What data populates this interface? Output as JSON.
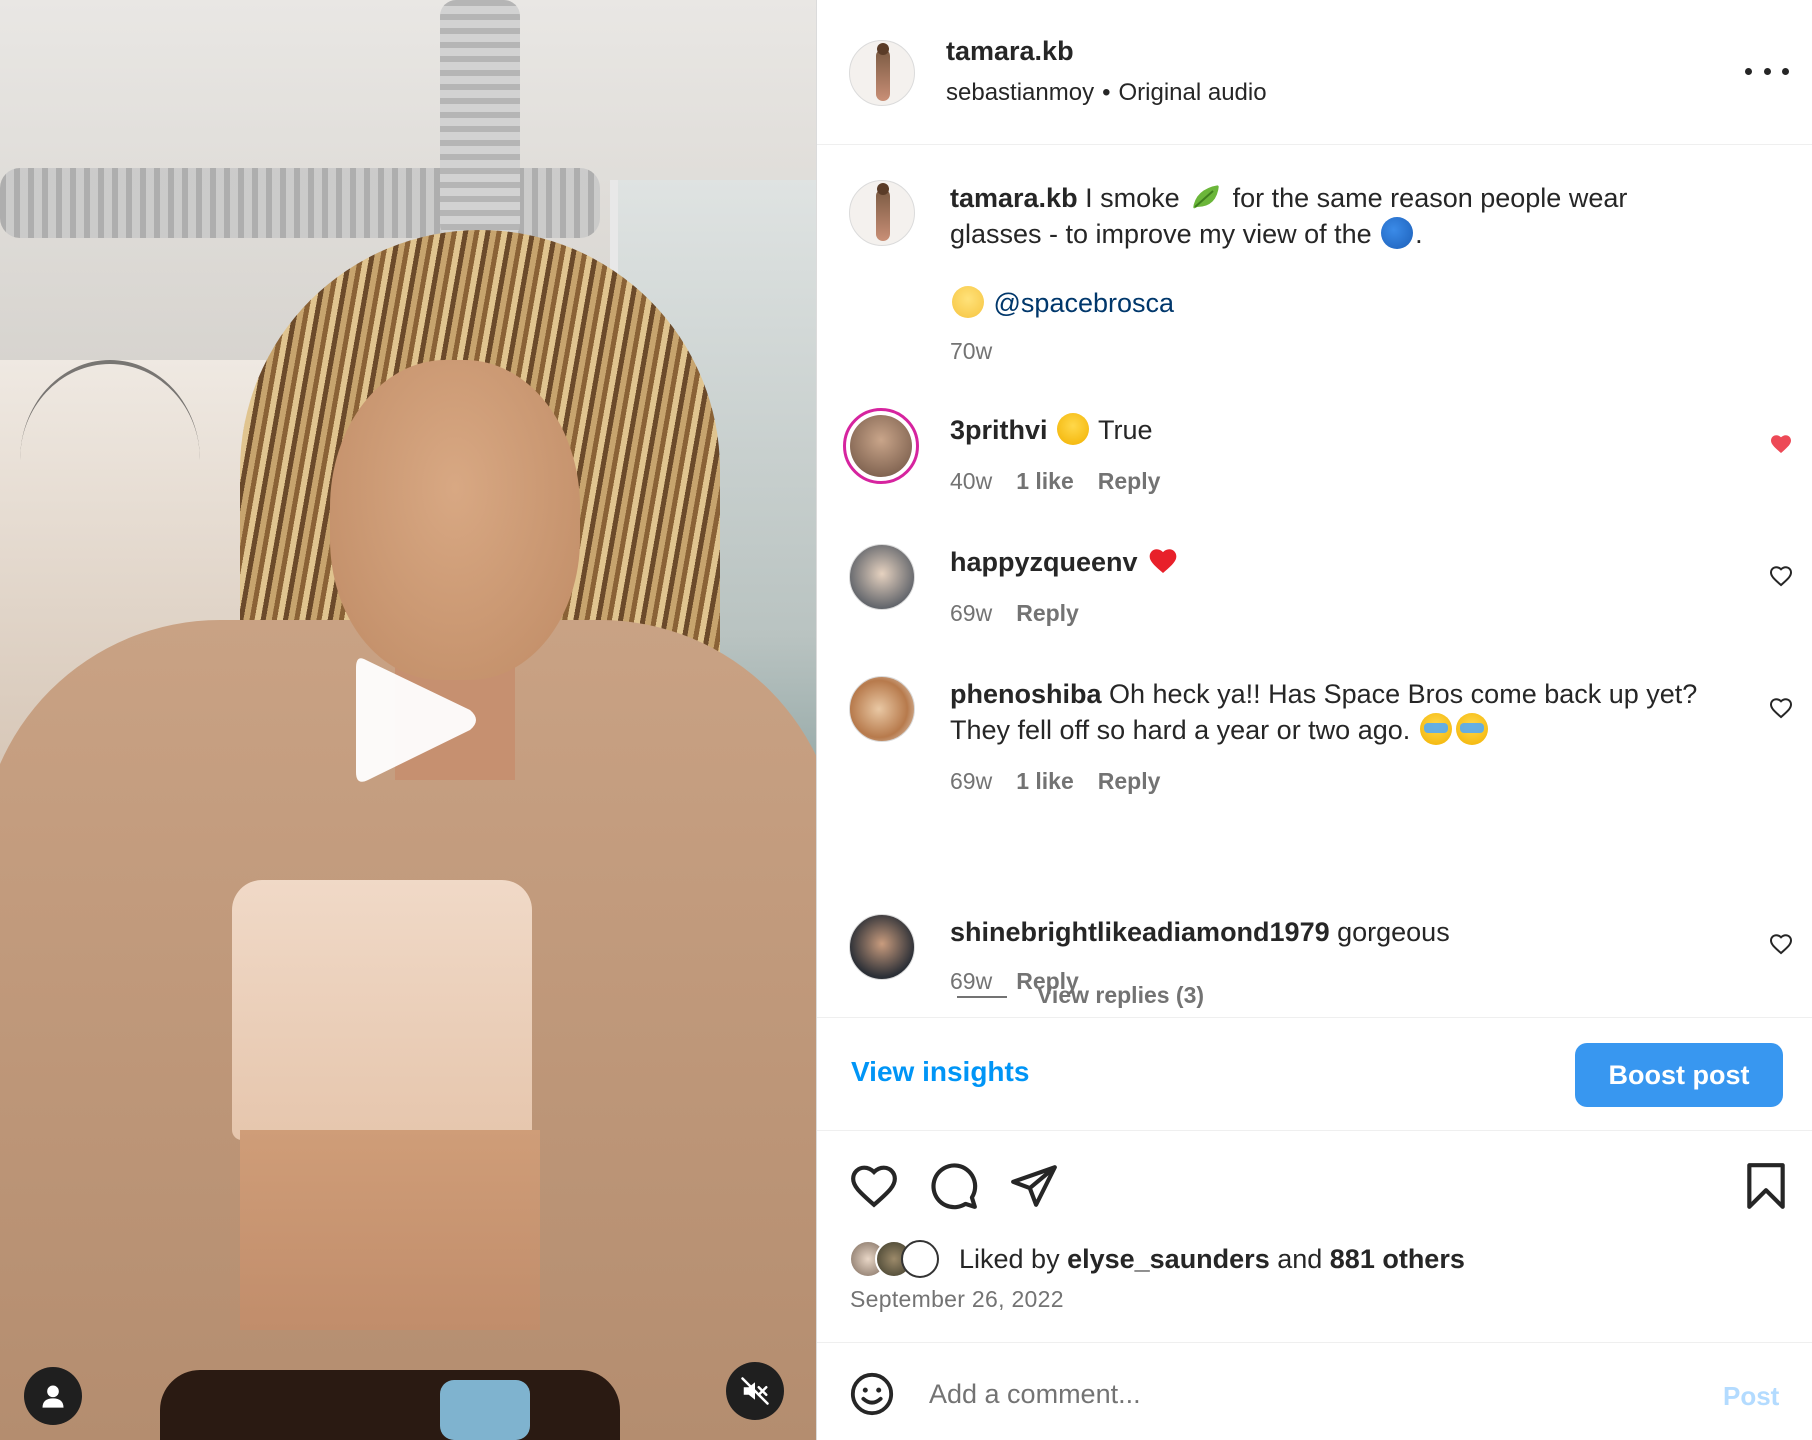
{
  "header": {
    "username": "tamara.kb",
    "audio_user": "sebastianmoy",
    "separator": "•",
    "audio_label": "Original audio"
  },
  "caption": {
    "username": "tamara.kb",
    "text_part1": " I smoke ",
    "text_part2": " for the same reason people wear glasses - to improve my view of the ",
    "text_part3": ".",
    "mention": "@spacebrosca",
    "time": "70w"
  },
  "comments": [
    {
      "username": "3prithvi",
      "text": " True",
      "time": "40w",
      "likes": "1 like",
      "reply": "Reply",
      "liked": true
    },
    {
      "username": "happyzqueenv",
      "text": "",
      "time": "69w",
      "reply": "Reply",
      "liked": false
    },
    {
      "username": "phenoshiba",
      "text": " Oh heck ya!! Has Space Bros come back up yet? They fell off so hard a year or two ago. ",
      "time": "69w",
      "likes": "1 like",
      "reply": "Reply",
      "liked": false
    },
    {
      "username": "shinebrightlikeadiamond1979",
      "text": " gorgeous",
      "time": "69w",
      "reply": "Reply",
      "liked": false
    }
  ],
  "view_replies": "View replies (3)",
  "insights": {
    "view_insights": "View insights",
    "boost_post": "Boost post"
  },
  "likes": {
    "prefix": "Liked by ",
    "user": "elyse_saunders",
    "middle": " and ",
    "count": "881 others"
  },
  "date": "September 26, 2022",
  "comment_box": {
    "placeholder": "Add a comment...",
    "post": "Post"
  },
  "colors": {
    "accent": "#0095f6",
    "boost": "#3897f0",
    "heart_red": "#ed4956",
    "post_disabled": "#b3dbff"
  },
  "icons": [
    "play-icon",
    "user-icon",
    "mute-icon",
    "more-icon",
    "heart-icon",
    "comment-icon",
    "share-icon",
    "bookmark-icon",
    "emoji-icon"
  ]
}
